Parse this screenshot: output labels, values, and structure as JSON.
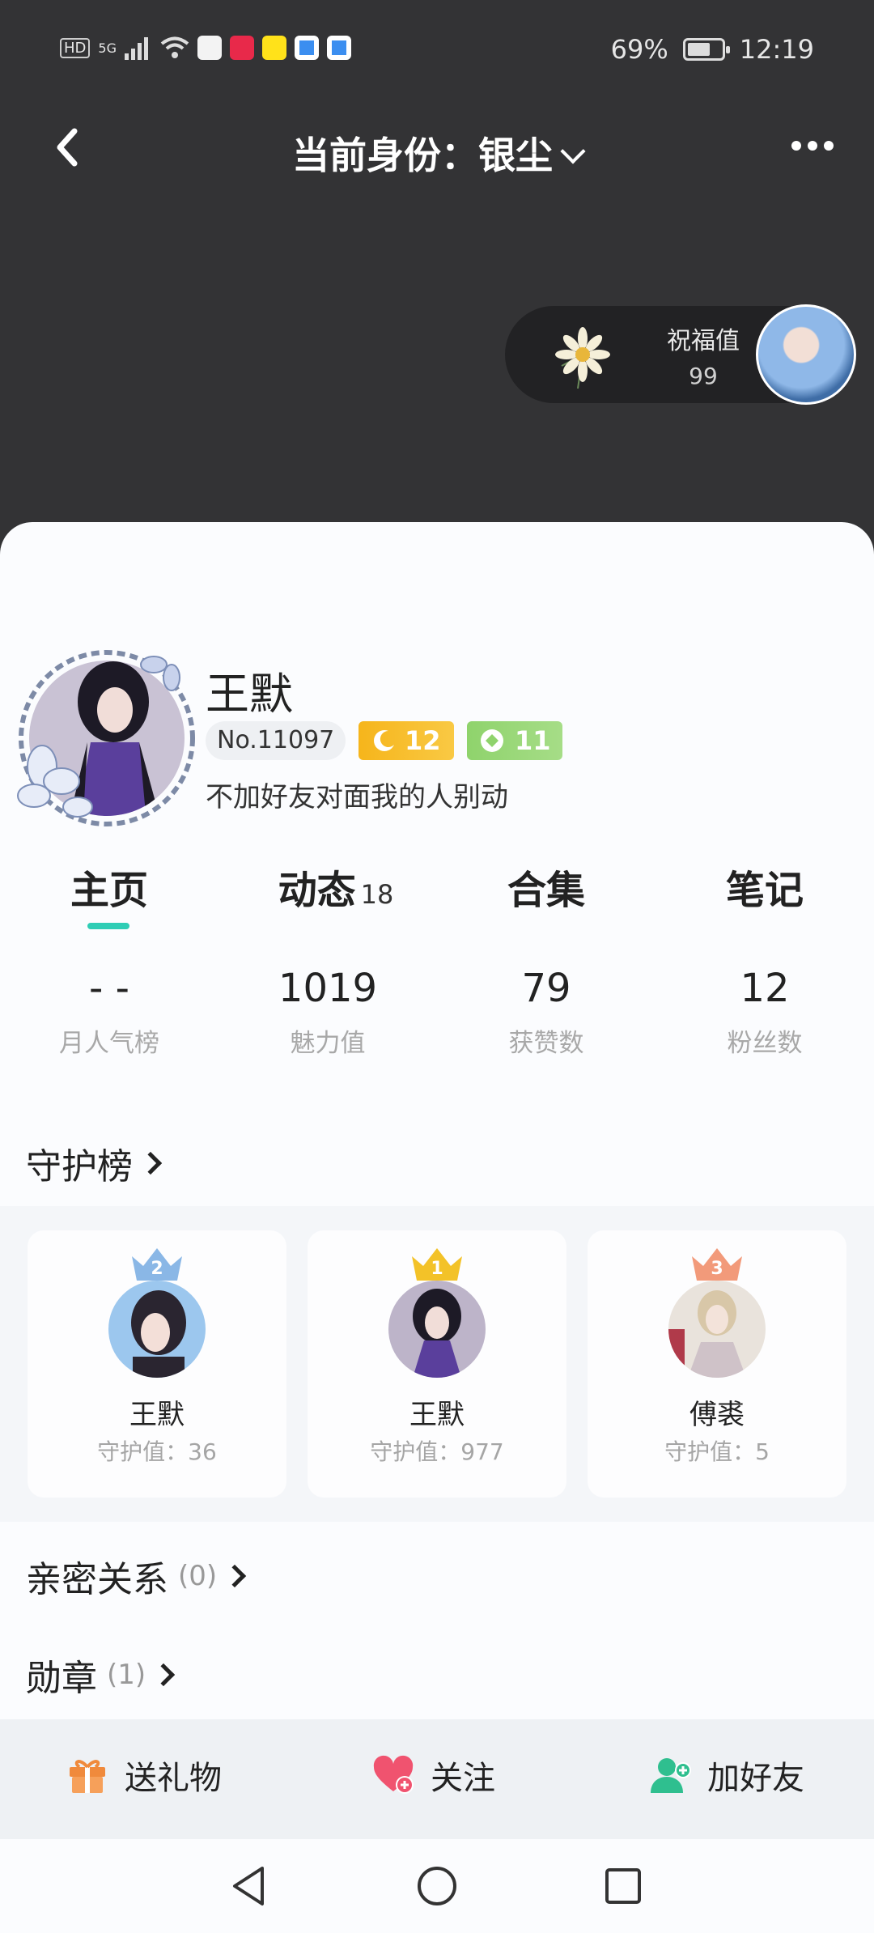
{
  "status_bar": {
    "left_label": "HD",
    "network": "5G",
    "battery_percent": "69%",
    "battery_level": 0.69,
    "time": "12:19",
    "app_icons": [
      "app-notification-icon",
      "app-notification-icon",
      "app-notification-icon",
      "app-notification-icon",
      "app-notification-icon"
    ]
  },
  "header": {
    "title": "当前身份：银尘",
    "back_icon": "back-arrow-icon",
    "more_icon": "more-icon"
  },
  "blessing": {
    "label": "祝福值",
    "value": "99"
  },
  "profile": {
    "name": "王默",
    "number_badge": "No.11097",
    "moon_level": "12",
    "diamond_level": "11",
    "bio": "不加好友对面我的人别动"
  },
  "tabs": [
    {
      "label": "主页",
      "count": ""
    },
    {
      "label": "动态",
      "count": "18"
    },
    {
      "label": "合集",
      "count": ""
    },
    {
      "label": "笔记",
      "count": ""
    }
  ],
  "stats": [
    {
      "value": "- -",
      "label": "月人气榜"
    },
    {
      "value": "1019",
      "label": "魅力值"
    },
    {
      "value": "79",
      "label": "获赞数"
    },
    {
      "value": "12",
      "label": "粉丝数"
    }
  ],
  "guardian": {
    "title": "守护榜",
    "entries": [
      {
        "rank": "2",
        "name": "王默",
        "value": "守护值：36"
      },
      {
        "rank": "1",
        "name": "王默",
        "value": "守护值：977"
      },
      {
        "rank": "3",
        "name": "傅裘",
        "value": "守护值：5"
      }
    ]
  },
  "intimate": {
    "title": "亲密关系",
    "count": "(0)"
  },
  "medals": {
    "title": "勋章",
    "count": "(1)"
  },
  "actions": {
    "gift": "送礼物",
    "follow": "关注",
    "add_friend": "加好友"
  },
  "colors": {
    "accent": "#2ecdb5",
    "header_bg": "#333335",
    "gold": "#f6b51b",
    "green": "#8fd36c",
    "gift_orange": "#f08a3c",
    "follow_pink": "#f0536f",
    "friend_green": "#2fbf8f"
  }
}
